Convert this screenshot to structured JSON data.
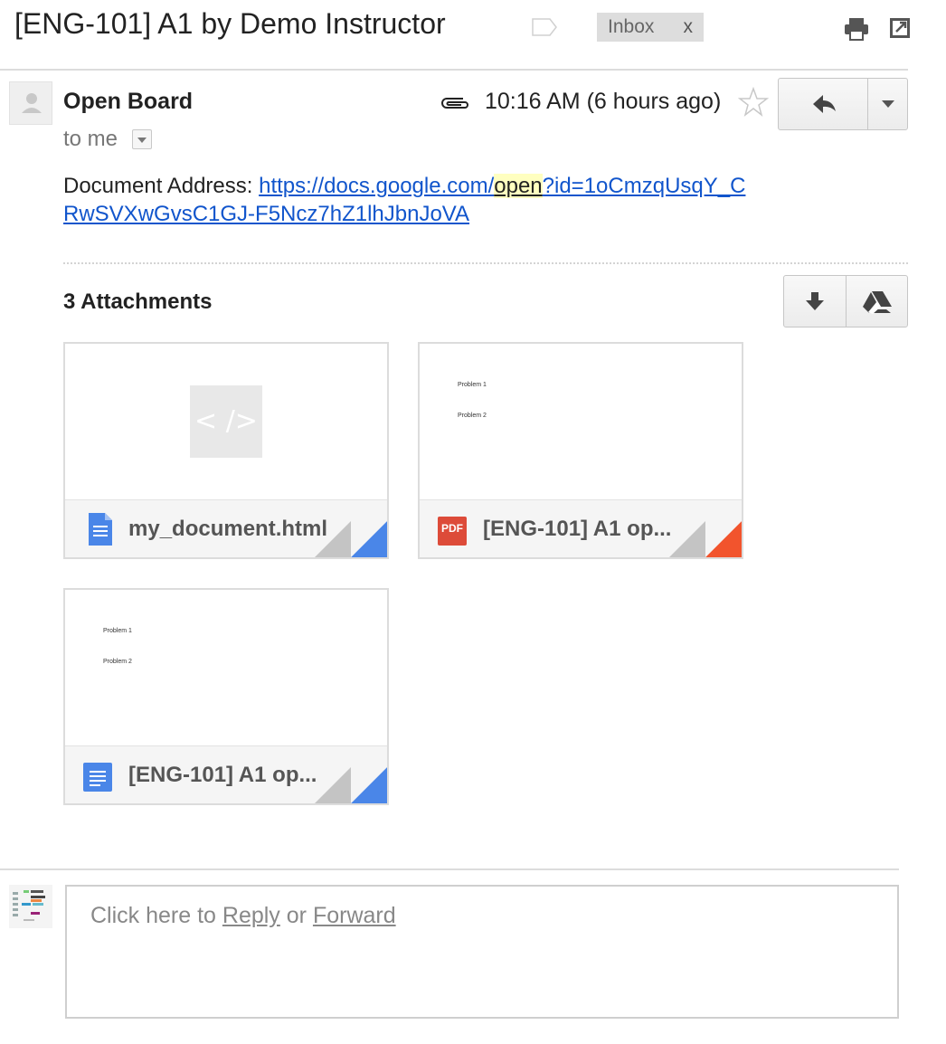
{
  "subject": "[ENG-101] A1 by Demo Instructor",
  "labels": [
    {
      "name": "Inbox",
      "remove": "x"
    }
  ],
  "message": {
    "sender": "Open Board",
    "recipient": "to me",
    "timestamp": "10:16 AM (6 hours ago)",
    "body_prefix": "Document Address: ",
    "link_part1": "https://docs.google.com/",
    "link_highlight": "open",
    "link_part2": "?id=1oCmzqUsqY_CRwSVXwGvsC1GJ-F5Ncz7hZ1lhJbnJoVA"
  },
  "attachments": {
    "title": "3 Attachments",
    "items": [
      {
        "name": "my_document.html",
        "kind": "html",
        "thumb_text": "< />",
        "fold_color": "#4a86e8"
      },
      {
        "name": "[ENG-101] A1 op...",
        "kind": "pdf",
        "icon_text": "PDF",
        "fold_color": "#f2542d",
        "lines": [
          "Problem 1",
          "Problem 2"
        ]
      },
      {
        "name": "[ENG-101] A1 op...",
        "kind": "gdoc",
        "fold_color": "#4a86e8",
        "lines": [
          "Problem 1",
          "Problem 2"
        ]
      }
    ]
  },
  "reply_box": {
    "prefix": "Click here to ",
    "reply": "Reply",
    "middle": " or ",
    "forward": "Forward"
  },
  "colors": {
    "link": "#1155cc",
    "highlight": "#ffffc0",
    "doc_blue": "#4a86e8",
    "pdf_red": "#dd4b39"
  }
}
